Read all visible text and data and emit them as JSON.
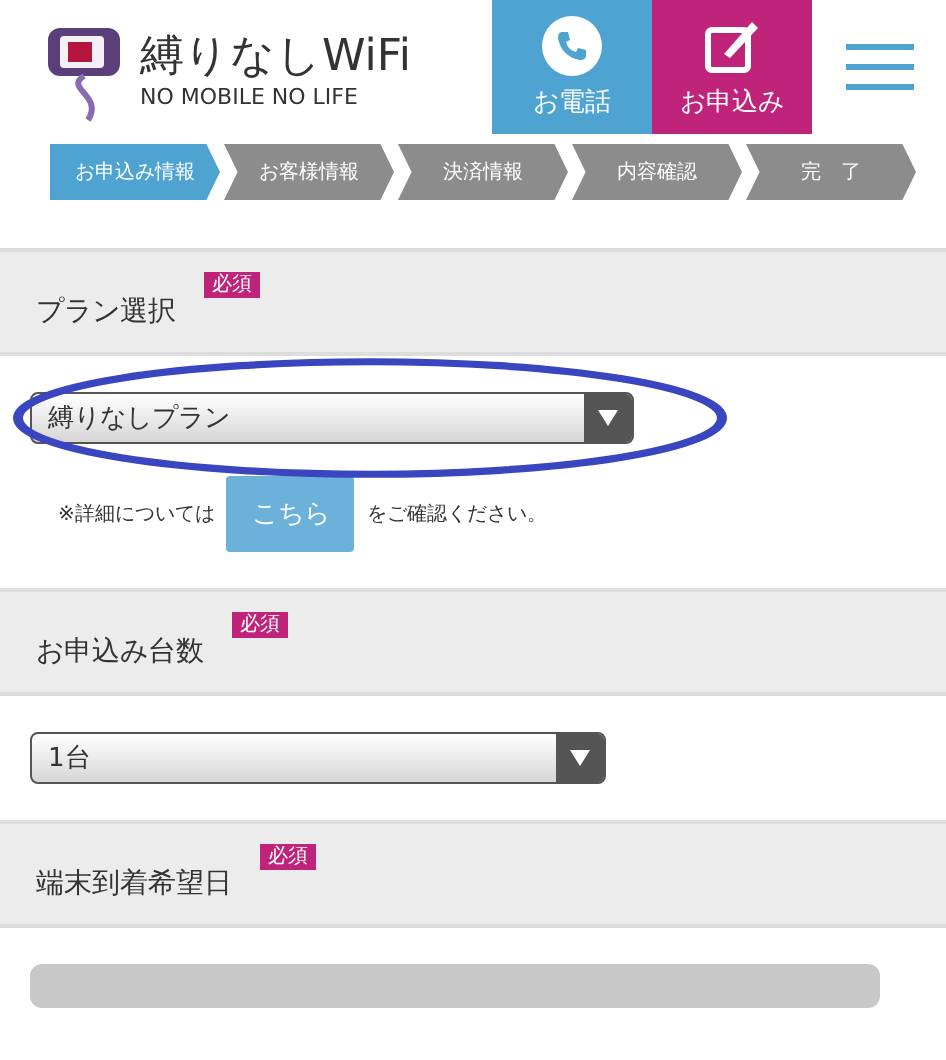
{
  "header": {
    "logo_title": "縛りなしWiFi",
    "logo_tagline": "NO MOBILE NO LIFE",
    "buttons": [
      {
        "kind": "phone",
        "label": "お電話"
      },
      {
        "kind": "apply",
        "label": "お申込み"
      }
    ]
  },
  "steps": [
    {
      "label": "お申込み情報",
      "selected": true
    },
    {
      "label": "お客様情報",
      "selected": false
    },
    {
      "label": "決済情報",
      "selected": false
    },
    {
      "label": "内容確認",
      "selected": false
    },
    {
      "label": "完　了",
      "selected": false
    }
  ],
  "sections": [
    {
      "title": "プラン選択",
      "badge": "必須",
      "kind": "select",
      "value": "縛りなしプラン",
      "highlighted": true,
      "note": {
        "before": "※詳細については",
        "button": "こちら",
        "after": "をご確認ください。"
      }
    },
    {
      "title": "お申込み台数",
      "badge": "必須",
      "kind": "select",
      "value": "1台",
      "highlighted": false
    },
    {
      "title": "端末到着希望日",
      "badge": "必須",
      "kind": "date"
    }
  ]
}
